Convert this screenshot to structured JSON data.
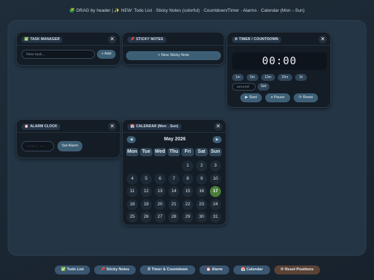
{
  "header": {
    "text": "🧩 DRAG by header | ✨ NEW: Todo List · Sticky Notes (colorful) · Countdown/Timer · Alarms · Calendar (Mon→Sun)"
  },
  "task_manager": {
    "icon": "✅",
    "title": "TASK MANAGER",
    "placeholder": "New task...",
    "add_label": "+ Add",
    "close": "✕"
  },
  "sticky_notes": {
    "icon": "📌",
    "title": "STICKY NOTES",
    "new_label": "+ New Sticky Note",
    "close": "✕"
  },
  "timer": {
    "icon": "⏱",
    "title": "TIMER / COUNTDOWN",
    "display": "00:00",
    "close": "✕",
    "presets": [
      "1m",
      "5m",
      "10m",
      "25m",
      "1h"
    ],
    "seconds_placeholder": "second",
    "set_label": "Set",
    "start_label": "▶ Start",
    "pause_label": "⏸ Pause",
    "reset_label": "⟳ Reset"
  },
  "alarm": {
    "icon": "⏰",
    "title": "ALARM CLOCK",
    "time_placeholder": "--:-- --",
    "set_label": "Set Alarm",
    "close": "✕"
  },
  "calendar": {
    "icon": "📅",
    "title": "CALENDAR (Mon→Sun)",
    "close": "✕",
    "month": "May 2026",
    "prev": "◀",
    "next": "▶",
    "weekdays": [
      "Mon",
      "Tue",
      "Wed",
      "Thu",
      "Fri",
      "Sat",
      "Sun"
    ],
    "days": [
      "1",
      "2",
      "3",
      "4",
      "5",
      "6",
      "7",
      "8",
      "9",
      "10",
      "11",
      "12",
      "13",
      "14",
      "15",
      "16",
      "17",
      "18",
      "19",
      "20",
      "21",
      "22",
      "23",
      "24",
      "25",
      "26",
      "27",
      "28",
      "29",
      "30",
      "31"
    ],
    "first_weekday_index": 4,
    "today": "17",
    "today_color": "#4a7c3a"
  },
  "dock": [
    {
      "label": "✅ Todo List"
    },
    {
      "label": "📌 Sticky Notes"
    },
    {
      "label": "⏱ Timer & Countdown"
    },
    {
      "label": "⏰ Alarm"
    },
    {
      "label": "📅 Calendar"
    },
    {
      "label": "⟳ Reset Positions"
    }
  ]
}
